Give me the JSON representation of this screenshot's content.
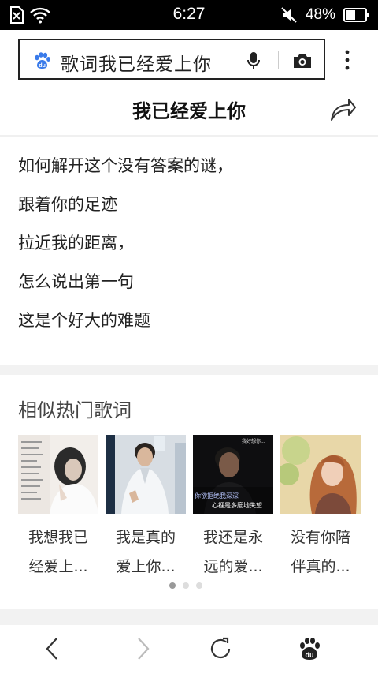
{
  "status_bar": {
    "time": "6:27",
    "battery_percent": "48%",
    "battery_level": 0.48
  },
  "search": {
    "query": "歌词我已经爱上你",
    "icons": [
      "baidu-paw-icon",
      "microphone-icon",
      "camera-icon"
    ]
  },
  "header": {
    "title": "我已经爱上你",
    "icons": [
      "more-icon",
      "share-icon"
    ]
  },
  "lyrics": [
    {
      "text": "如何解开这个没有答案的谜，"
    },
    {
      "text": "跟着你的足迹"
    },
    {
      "text": "拉近我的距离，"
    },
    {
      "text": "怎么说出第一句"
    },
    {
      "text": "这是个好大的难题"
    }
  ],
  "similar": {
    "title": "相似热门歌词",
    "cards": [
      {
        "line1": "我想我已",
        "line2": "经爱上..."
      },
      {
        "line1": "我是真的",
        "line2": "爱上你..."
      },
      {
        "line1": "我还是永",
        "line2": "远的爱..."
      },
      {
        "line1": "没有你陪",
        "line2": "伴真的..."
      }
    ],
    "thumb_texts": {
      "t3_top": "我好想你...",
      "t3_a": "你欲拒绝我深深",
      "t3_b": "心裡是多麼地失望"
    },
    "pagination": {
      "pages": 3,
      "active": 1
    }
  },
  "bottom_nav": {
    "items": [
      "back-icon",
      "forward-icon",
      "refresh-icon",
      "baidu-home-icon"
    ]
  },
  "colors": {
    "paw_blue": "#3a7bea",
    "status_bg": "#000000",
    "section_gap": "#f2f2f2"
  }
}
